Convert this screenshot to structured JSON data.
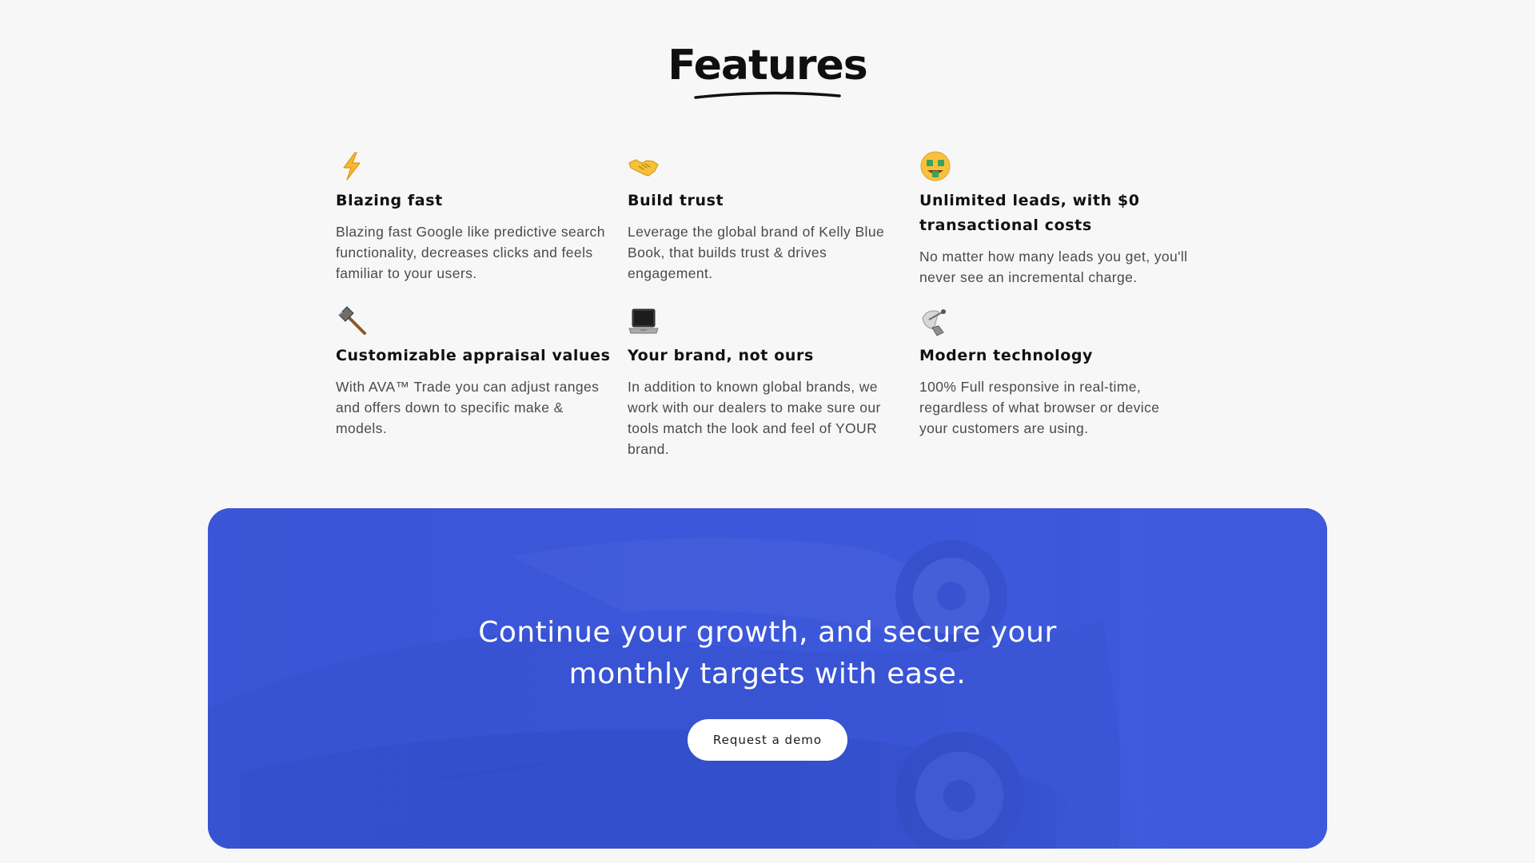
{
  "features_section": {
    "title": "Features",
    "items": [
      {
        "icon": "lightning-icon",
        "title": "Blazing fast",
        "description": "Blazing fast Google like predictive search functionality, decreases clicks and feels familiar to your users."
      },
      {
        "icon": "handshake-icon",
        "title": "Build trust",
        "description": "Leverage the global brand of Kelly Blue Book, that builds trust & drives engagement."
      },
      {
        "icon": "money-mouth-face-icon",
        "title": "Unlimited leads, with $0 transactional costs",
        "description": "No matter how many leads you get, you'll never see an incremental charge."
      },
      {
        "icon": "hammer-icon",
        "title": "Customizable appraisal values",
        "description": "With AVA™ Trade you can adjust ranges and offers down to specific make & models."
      },
      {
        "icon": "laptop-icon",
        "title": "Your brand, not ours",
        "description": "In addition to known global brands, we work with our dealers to make sure our tools match the look and feel of YOUR brand."
      },
      {
        "icon": "satellite-dish-icon",
        "title": "Modern technology",
        "description": "100% Full responsive in real-time, regardless of what browser or device your customers are using."
      }
    ]
  },
  "cta": {
    "headline": "Continue your growth, and  secure your monthly targets with ease.",
    "button_label": "Request a demo"
  },
  "colors": {
    "page_background": "#f7f7f7",
    "banner_blue": "#3b55d6",
    "button_background": "#ffffff",
    "lightning_yellow": "#f5b82e"
  }
}
